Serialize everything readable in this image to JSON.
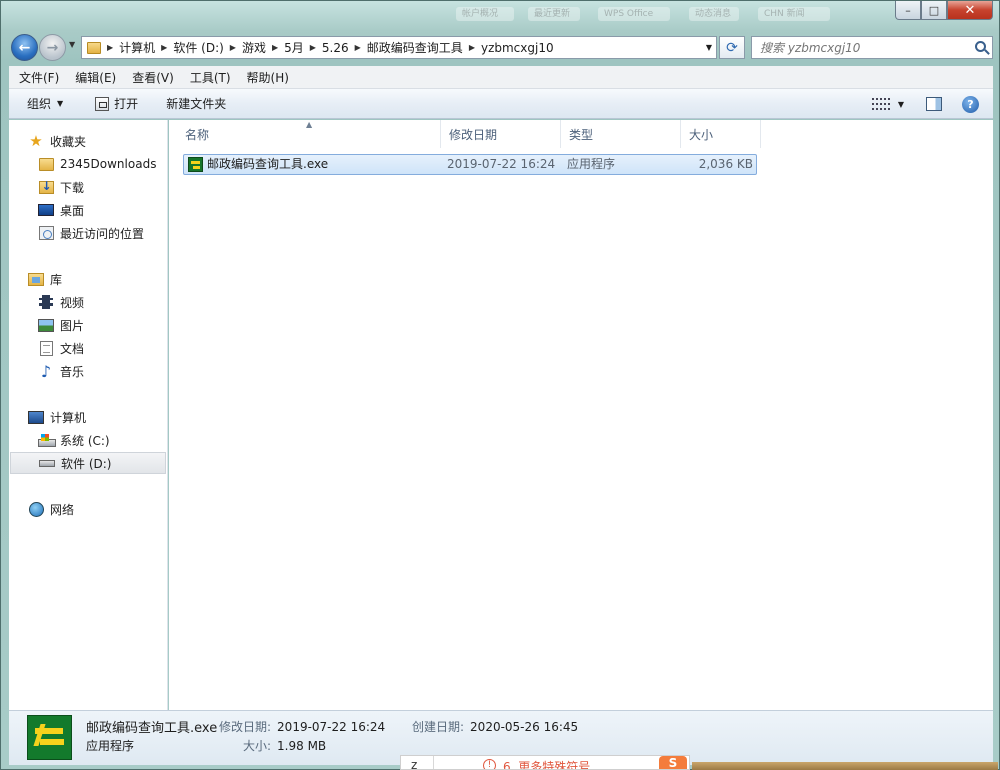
{
  "window": {
    "background_tabs": [
      "帐户概况",
      "最近更新",
      "WPS Office",
      "动态消息",
      "CHN 新闻"
    ],
    "controls": {
      "minimize": "–",
      "maximize": "□",
      "close": "✕"
    }
  },
  "address_bar": {
    "crumbs": [
      "计算机",
      "软件 (D:)",
      "游戏",
      "5月",
      "5.26",
      "邮政编码查询工具",
      "yzbmcxgj10"
    ]
  },
  "search": {
    "placeholder": "搜索 yzbmcxgj10"
  },
  "menu": [
    "文件(F)",
    "编辑(E)",
    "查看(V)",
    "工具(T)",
    "帮助(H)"
  ],
  "toolbar": {
    "organize": "组织",
    "open": "打开",
    "new_folder": "新建文件夹"
  },
  "nav_pane": {
    "favorites": {
      "label": "收藏夹",
      "items": [
        "2345Downloads",
        "下载",
        "桌面",
        "最近访问的位置"
      ]
    },
    "libraries": {
      "label": "库",
      "items": [
        "视频",
        "图片",
        "文档",
        "音乐"
      ]
    },
    "computer": {
      "label": "计算机",
      "items": [
        "系统 (C:)",
        "软件 (D:)"
      ],
      "selected": "软件 (D:)"
    },
    "network": {
      "label": "网络"
    }
  },
  "columns": {
    "name": "名称",
    "modified": "修改日期",
    "type": "类型",
    "size": "大小"
  },
  "files": [
    {
      "name": "邮政编码查询工具.exe",
      "modified": "2019-07-22 16:24",
      "type": "应用程序",
      "size": "2,036 KB",
      "selected": true
    }
  ],
  "details": {
    "name": "邮政编码查询工具.exe",
    "type": "应用程序",
    "modified_label": "修改日期:",
    "modified": "2019-07-22 16:24",
    "created_label": "创建日期:",
    "created": "2020-05-26 16:45",
    "size_label": "大小:",
    "size": "1.98 MB"
  },
  "popup": {
    "z": "z",
    "text": "6. 更多特殊符号"
  }
}
